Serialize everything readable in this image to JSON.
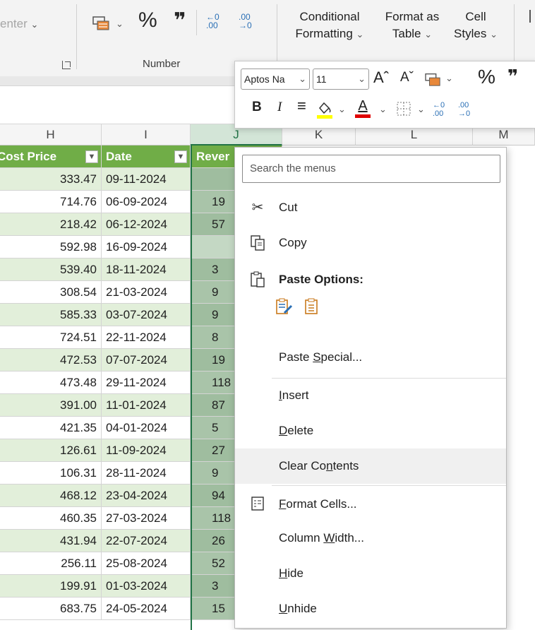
{
  "ribbon": {
    "align_center_label": "enter",
    "percent_symbol": "%",
    "comma_symbol": "\"",
    "increase_decimal": "←.0\n.00",
    "decrease_decimal": ".00\n→.0",
    "conditional_formatting": [
      "Conditional",
      "Formatting"
    ],
    "format_as_table": [
      "Format as",
      "Table"
    ],
    "cell_styles": [
      "Cell",
      "Styles"
    ],
    "number_group_label": "Number"
  },
  "mini_toolbar": {
    "font_name": "Aptos Na",
    "font_size": "11",
    "grow_font": "Aˆ",
    "shrink_font": "Aˇ",
    "percent": "%",
    "comma": "\"",
    "bold": "B",
    "italic": "I"
  },
  "columns": [
    "H",
    "I",
    "J",
    "K",
    "L",
    "M"
  ],
  "table_headers": {
    "h": "Cost Price",
    "i": "Date",
    "j": "Rever"
  },
  "rows": [
    {
      "cost": "333.47",
      "date": "09-11-2024",
      "rev": ""
    },
    {
      "cost": "714.76",
      "date": "06-09-2024",
      "rev": "19"
    },
    {
      "cost": "218.42",
      "date": "06-12-2024",
      "rev": "57"
    },
    {
      "cost": "592.98",
      "date": "16-09-2024",
      "rev": ""
    },
    {
      "cost": "539.40",
      "date": "18-11-2024",
      "rev": "3"
    },
    {
      "cost": "308.54",
      "date": "21-03-2024",
      "rev": "9"
    },
    {
      "cost": "585.33",
      "date": "03-07-2024",
      "rev": "9"
    },
    {
      "cost": "724.51",
      "date": "22-11-2024",
      "rev": "8"
    },
    {
      "cost": "472.53",
      "date": "07-07-2024",
      "rev": "19"
    },
    {
      "cost": "473.48",
      "date": "29-11-2024",
      "rev": "118"
    },
    {
      "cost": "391.00",
      "date": "11-01-2024",
      "rev": "87"
    },
    {
      "cost": "421.35",
      "date": "04-01-2024",
      "rev": "5"
    },
    {
      "cost": "126.61",
      "date": "11-09-2024",
      "rev": "27"
    },
    {
      "cost": "106.31",
      "date": "28-11-2024",
      "rev": "9"
    },
    {
      "cost": "468.12",
      "date": "23-04-2024",
      "rev": "94"
    },
    {
      "cost": "460.35",
      "date": "27-03-2024",
      "rev": "118"
    },
    {
      "cost": "431.94",
      "date": "22-07-2024",
      "rev": "26"
    },
    {
      "cost": "256.11",
      "date": "25-08-2024",
      "rev": "52"
    },
    {
      "cost": "199.91",
      "date": "01-03-2024",
      "rev": "3"
    },
    {
      "cost": "683.75",
      "date": "24-05-2024",
      "rev": "15"
    }
  ],
  "context_menu": {
    "search_placeholder": "Search the menus",
    "cut": "Cut",
    "copy": "Copy",
    "paste_options": "Paste Options:",
    "paste_special": "Paste Special...",
    "insert": "Insert",
    "delete": "Delete",
    "clear_contents": "Clear Contents",
    "format_cells": "Format Cells...",
    "column_width": "Column Width...",
    "hide": "Hide",
    "unhide": "Unhide"
  },
  "colors": {
    "table_header_green": "#70ad47",
    "band_green": "#e2efda",
    "selection_green": "#217346",
    "font_color_red": "#e00000",
    "highlight_yellow": "#ffff00"
  }
}
